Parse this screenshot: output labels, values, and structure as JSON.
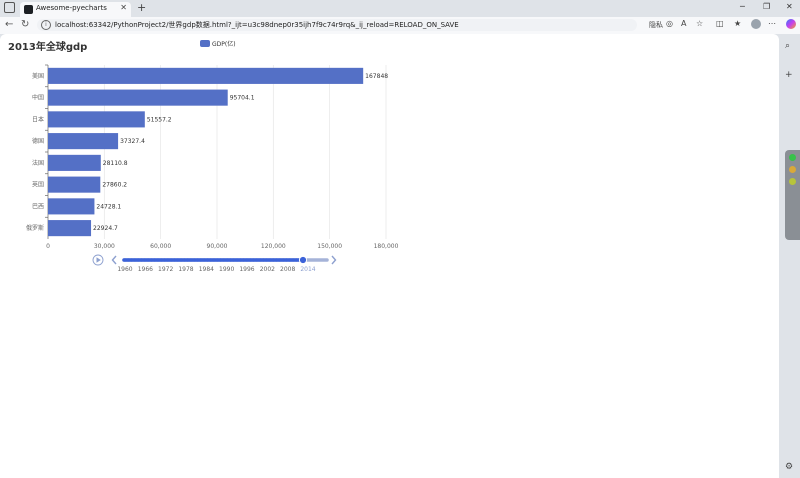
{
  "browser": {
    "tab_title": "Awesome-pyecharts",
    "url": "localhost:63342/PythonProject2/世界gdp数据.html?_ijt=u3c98dnep0r35ijh7f9c74r9rq&_ij_reload=RELOAD_ON_SAVE",
    "toolbar_text": "隐私"
  },
  "chart": {
    "title": "2013年全球gdp",
    "legend": "GDP(亿)",
    "timeline": [
      "1960",
      "1966",
      "1972",
      "1978",
      "1984",
      "1990",
      "1996",
      "2002",
      "2008",
      "2014"
    ]
  },
  "chart_data": {
    "type": "bar",
    "orientation": "horizontal",
    "title": "2013年全球gdp",
    "categories": [
      "美国",
      "中国",
      "日本",
      "德国",
      "法国",
      "英国",
      "巴西",
      "俄罗斯"
    ],
    "series": [
      {
        "name": "GDP(亿)",
        "values": [
          167848,
          95704.1,
          51557.2,
          37327.4,
          28110.8,
          27860.2,
          24728.1,
          22924.7
        ]
      }
    ],
    "x_ticks": [
      "0",
      "30,000",
      "60,000",
      "90,000",
      "120,000",
      "150,000",
      "180,000"
    ],
    "xlim": [
      0,
      180000
    ],
    "grid": true,
    "color": "#5470c6"
  }
}
